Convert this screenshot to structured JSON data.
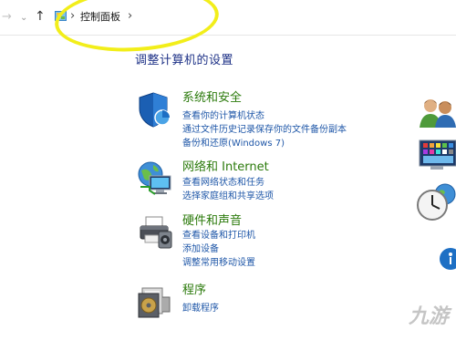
{
  "address": {
    "breadcrumb": "控制面板",
    "separator": "›"
  },
  "nav": {
    "back": "→",
    "dropdown": "⌄",
    "up": "↑"
  },
  "page_title": "调整计算机的设置",
  "categories": [
    {
      "title": "系统和安全",
      "links": [
        "查看你的计算机状态",
        "通过文件历史记录保存你的文件备份副本",
        "备份和还原(Windows 7)"
      ],
      "icon": "shield-icon"
    },
    {
      "title": "网络和 Internet",
      "links": [
        "查看网络状态和任务",
        "选择家庭组和共享选项"
      ],
      "icon": "network-globe-icon"
    },
    {
      "title": "硬件和声音",
      "links": [
        "查看设备和打印机",
        "添加设备",
        "调整常用移动设置"
      ],
      "icon": "printer-icon"
    },
    {
      "title": "程序",
      "links": [
        "卸载程序"
      ],
      "icon": "programs-disk-icon"
    }
  ],
  "watermark": "九游",
  "colors": {
    "category_title": "#2b7a0b",
    "link": "#1f57a8",
    "page_title": "#1e3287",
    "highlight_ellipse": "#f2ee1a"
  }
}
